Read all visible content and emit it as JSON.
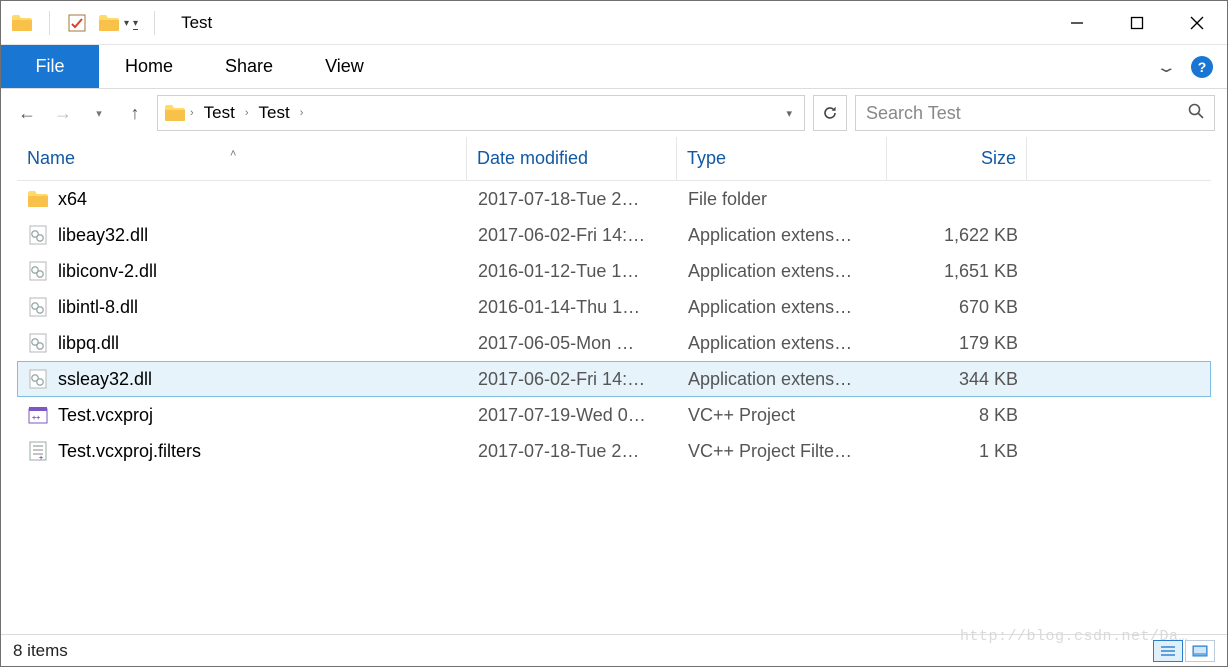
{
  "titlebar": {
    "title": "Test"
  },
  "ribbon": {
    "file": "File",
    "tabs": [
      "Home",
      "Share",
      "View"
    ]
  },
  "breadcrumb": {
    "parts": [
      "Test",
      "Test"
    ]
  },
  "search": {
    "placeholder": "Search Test"
  },
  "columns": {
    "name": "Name",
    "date": "Date modified",
    "type": "Type",
    "size": "Size",
    "sort_asc_on": "name"
  },
  "files": [
    {
      "icon": "folder",
      "name": "x64",
      "date": "2017-07-18-Tue 2…",
      "type": "File folder",
      "size": "",
      "selected": false
    },
    {
      "icon": "dll",
      "name": "libeay32.dll",
      "date": "2017-06-02-Fri 14:…",
      "type": "Application extens…",
      "size": "1,622 KB",
      "selected": false
    },
    {
      "icon": "dll",
      "name": "libiconv-2.dll",
      "date": "2016-01-12-Tue 1…",
      "type": "Application extens…",
      "size": "1,651 KB",
      "selected": false
    },
    {
      "icon": "dll",
      "name": "libintl-8.dll",
      "date": "2016-01-14-Thu 1…",
      "type": "Application extens…",
      "size": "670 KB",
      "selected": false
    },
    {
      "icon": "dll",
      "name": "libpq.dll",
      "date": "2017-06-05-Mon …",
      "type": "Application extens…",
      "size": "179 KB",
      "selected": false
    },
    {
      "icon": "dll",
      "name": "ssleay32.dll",
      "date": "2017-06-02-Fri 14:…",
      "type": "Application extens…",
      "size": "344 KB",
      "selected": true
    },
    {
      "icon": "vcproj",
      "name": "Test.vcxproj",
      "date": "2017-07-19-Wed 0…",
      "type": "VC++ Project",
      "size": "8 KB",
      "selected": false
    },
    {
      "icon": "filter",
      "name": "Test.vcxproj.filters",
      "date": "2017-07-18-Tue 2…",
      "type": "VC++ Project Filte…",
      "size": "1 KB",
      "selected": false
    }
  ],
  "status": {
    "text": "8 items"
  },
  "watermark": "http://blog.csdn.net/Da…"
}
